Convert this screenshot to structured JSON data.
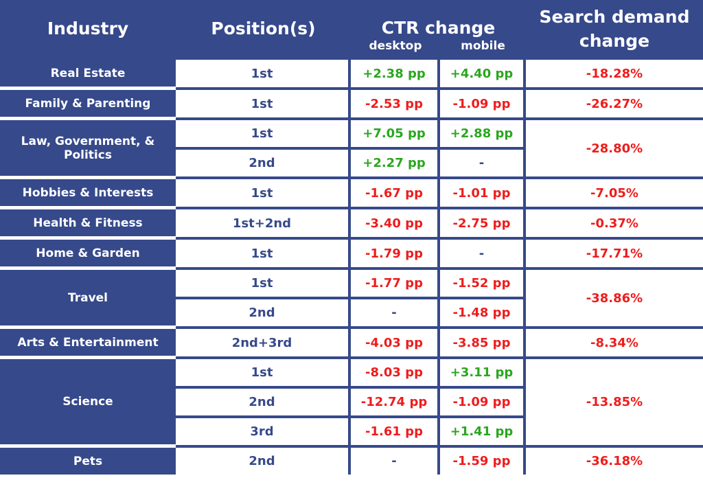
{
  "headers": {
    "industry": "Industry",
    "positions": "Position(s)",
    "ctr_change": "CTR change",
    "desktop": "desktop",
    "mobile": "mobile",
    "search_demand": "Search demand change"
  },
  "colors": {
    "header_bg": "#36498a",
    "positive": "#2aa61f",
    "negative": "#ee1c1c"
  },
  "chart_data": {
    "type": "table",
    "columns": [
      "Industry",
      "Position(s)",
      "CTR change desktop",
      "CTR change mobile",
      "Search demand change"
    ],
    "rows": [
      {
        "industry": "Real Estate",
        "demand": "-18.28%",
        "positions": [
          {
            "pos": "1st",
            "desktop": "+2.38 pp",
            "mobile": "+4.40 pp"
          }
        ]
      },
      {
        "industry": "Family & Parenting",
        "demand": "-26.27%",
        "positions": [
          {
            "pos": "1st",
            "desktop": "-2.53 pp",
            "mobile": "-1.09 pp"
          }
        ]
      },
      {
        "industry": "Law, Government, & Politics",
        "demand": "-28.80%",
        "positions": [
          {
            "pos": "1st",
            "desktop": "+7.05 pp",
            "mobile": "+2.88 pp"
          },
          {
            "pos": "2nd",
            "desktop": "+2.27 pp",
            "mobile": "-"
          }
        ]
      },
      {
        "industry": "Hobbies & Interests",
        "demand": "-7.05%",
        "positions": [
          {
            "pos": "1st",
            "desktop": "-1.67 pp",
            "mobile": "-1.01 pp"
          }
        ]
      },
      {
        "industry": "Health & Fitness",
        "demand": "-0.37%",
        "positions": [
          {
            "pos": "1st+2nd",
            "desktop": "-3.40 pp",
            "mobile": "-2.75 pp"
          }
        ]
      },
      {
        "industry": "Home & Garden",
        "demand": "-17.71%",
        "positions": [
          {
            "pos": "1st",
            "desktop": "-1.79 pp",
            "mobile": "-"
          }
        ]
      },
      {
        "industry": "Travel",
        "demand": "-38.86%",
        "positions": [
          {
            "pos": "1st",
            "desktop": "-1.77 pp",
            "mobile": "-1.52 pp"
          },
          {
            "pos": "2nd",
            "desktop": "-",
            "mobile": "-1.48 pp"
          }
        ]
      },
      {
        "industry": "Arts & Entertainment",
        "demand": "-8.34%",
        "positions": [
          {
            "pos": "2nd+3rd",
            "desktop": "-4.03 pp",
            "mobile": "-3.85 pp"
          }
        ]
      },
      {
        "industry": "Science",
        "demand": "-13.85%",
        "positions": [
          {
            "pos": "1st",
            "desktop": "-8.03 pp",
            "mobile": "+3.11 pp"
          },
          {
            "pos": "2nd",
            "desktop": "-12.74 pp",
            "mobile": "-1.09 pp"
          },
          {
            "pos": "3rd",
            "desktop": "-1.61 pp",
            "mobile": "+1.41 pp"
          }
        ]
      },
      {
        "industry": "Pets",
        "demand": "-36.18%",
        "positions": [
          {
            "pos": "2nd",
            "desktop": "-",
            "mobile": "-1.59 pp"
          }
        ]
      }
    ]
  }
}
